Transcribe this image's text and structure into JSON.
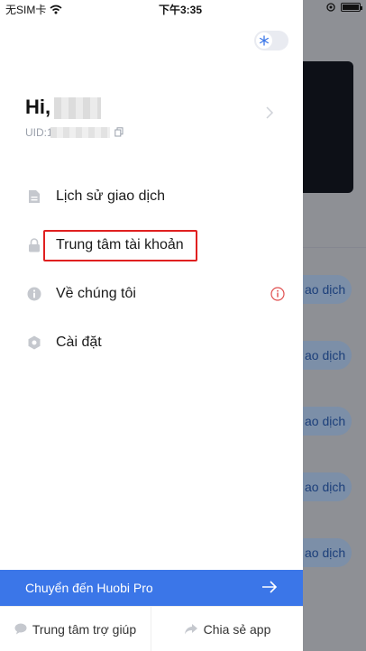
{
  "status_bar": {
    "carrier": "无SIM卡",
    "time": "下午3:35"
  },
  "drawer": {
    "greeting": "Hi,",
    "uid_label": "UID:1",
    "menu": [
      {
        "label": "Lịch sử giao dịch",
        "icon": "document-icon"
      },
      {
        "label": "Trung tâm tài khoản",
        "icon": "lock-icon"
      },
      {
        "label": "Về chúng tôi",
        "icon": "info-icon"
      },
      {
        "label": "Cài đặt",
        "icon": "gear-icon"
      }
    ],
    "cta_label": "Chuyển đến Huobi Pro",
    "footer": {
      "help_label": "Trung tâm trợ giúp",
      "share_label": "Chia sẻ app"
    }
  },
  "background": {
    "pill_label": "ao dịch"
  },
  "colors": {
    "accent": "#3b76e8",
    "highlight": "#e02020",
    "overlay": "#8f9196"
  }
}
